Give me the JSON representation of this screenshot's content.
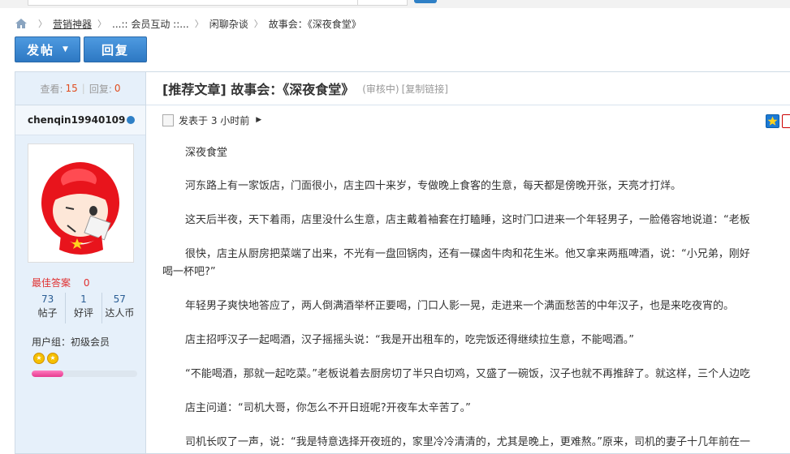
{
  "breadcrumb": {
    "items": [
      "营销神器",
      "...:: 会员互动 ::...",
      "闲聊杂谈",
      "故事会：《深夜食堂》"
    ]
  },
  "toolbar": {
    "post_label": "发帖",
    "reply_label": "回复"
  },
  "sidebar": {
    "views_label": "查看:",
    "views": "15",
    "replies_label": "回复:",
    "replies": "0",
    "author": "chenqin19940109",
    "best_answer_label": "最佳答案",
    "best_answer_value": "0",
    "counters": [
      {
        "value": "73",
        "label": "帖子"
      },
      {
        "value": "1",
        "label": "好评"
      },
      {
        "value": "57",
        "label": "达人币"
      }
    ],
    "group": "用户组：初级会员",
    "level_progress": 0.3
  },
  "thread": {
    "title": "[推荐文章] 故事会：《深夜食堂》",
    "status": "(审核中)",
    "copy_link": "[复制链接]",
    "posted": "发表于 3 小时前",
    "paragraphs": [
      "深夜食堂",
      "河东路上有一家饭店，门面很小，店主四十来岁，专做晚上食客的生意，每天都是傍晚开张，天亮才打烊。",
      "这天后半夜，天下着雨，店里没什么生意，店主戴着袖套在打瞌睡，这时门口进来一个年轻男子，一脸倦容地说道：“老板",
      "很快，店主从厨房把菜端了出来，不光有一盘回锅肉，还有一碟卤牛肉和花生米。他又拿来两瓶啤酒，说：“小兄弟，刚好",
      "喝一杯吧?”",
      "年轻男子爽快地答应了，两人倒满酒举杯正要喝，门口人影一晃，走进来一个满面愁苦的中年汉子，也是来吃夜宵的。",
      "店主招呼汉子一起喝酒，汉子摇摇头说：“我是开出租车的，吃完饭还得继续拉生意，不能喝酒。”",
      "“不能喝酒，那就一起吃菜。”老板说着去厨房切了半只白切鸡，又盛了一碗饭，汉子也就不再推辞了。就这样，三个人边吃",
      "店主问道：“司机大哥，你怎么不开日班呢?开夜车太辛苦了。”",
      "司机长叹了一声，说：“我是特意选择开夜班的，家里冷冷清清的，尤其是晚上，更难熬。”原来，司机的妻子十几年前在一"
    ]
  },
  "colors": {
    "accent": "#2f80c6",
    "hot": "#e04b1d",
    "sidebar_bg": "#e6f0fa"
  }
}
